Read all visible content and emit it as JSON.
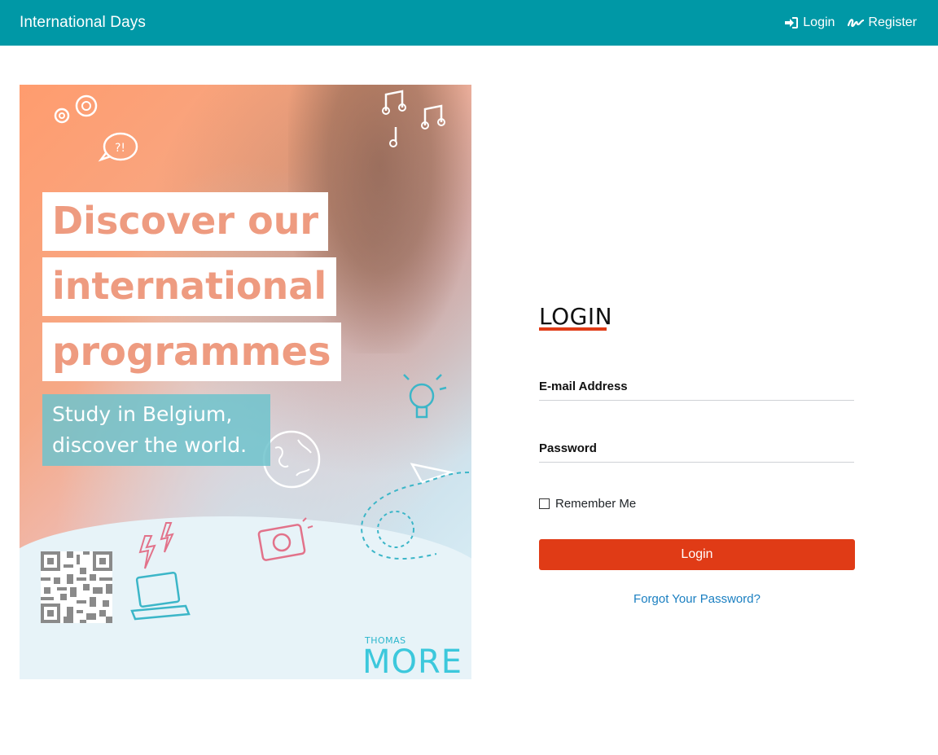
{
  "navbar": {
    "brand": "International Days",
    "login_label": "Login",
    "register_label": "Register",
    "background": "#0098a6"
  },
  "poster": {
    "headline": [
      "Discover our",
      "international",
      "programmes"
    ],
    "subline": [
      "Study in Belgium,",
      "discover the world."
    ],
    "logo_small": "THOMAS",
    "logo_big": "MORE"
  },
  "login": {
    "title": "LOGIN",
    "email_label": "E-mail Address",
    "email_value": "",
    "password_label": "Password",
    "password_value": "",
    "remember_label": "Remember Me",
    "remember_checked": false,
    "submit_label": "Login",
    "forgot_label": "Forgot Your Password?",
    "accent": "#e03b16",
    "link_color": "#1a7fc1"
  }
}
